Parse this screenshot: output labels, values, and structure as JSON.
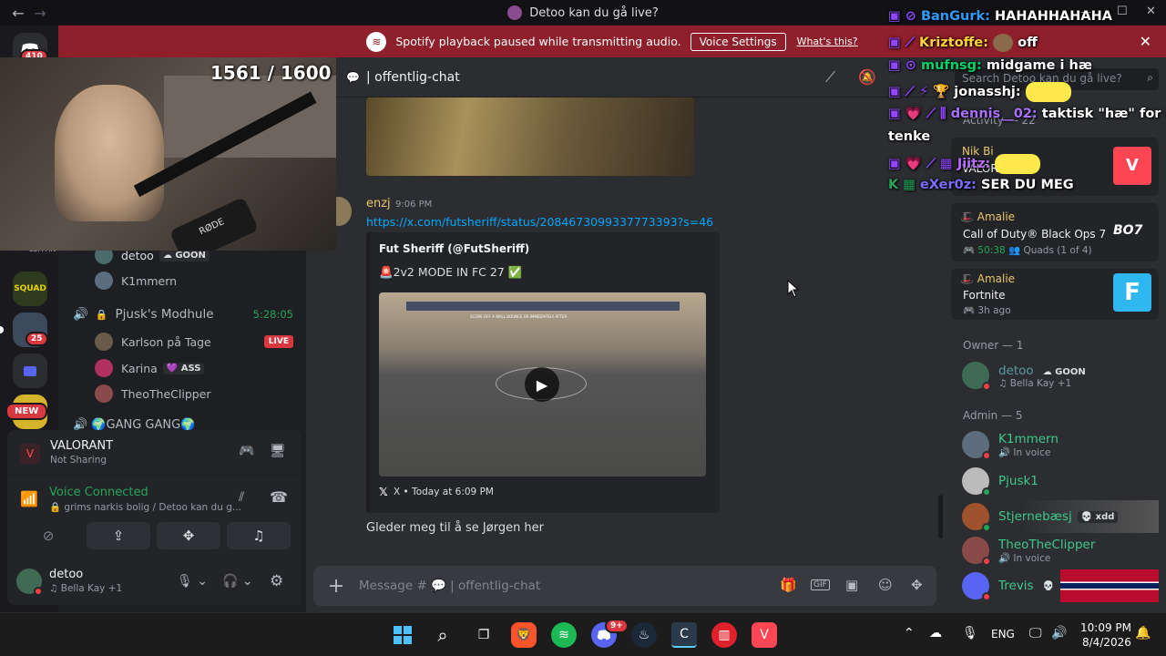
{
  "titlebar": {
    "title": "Detoo kan du gå live?",
    "back": "←",
    "forward": "→",
    "minimize": "—",
    "maximize": "☐",
    "close": "✕"
  },
  "notice": {
    "text": "Spotify playback paused while transmitting audio.",
    "button": "Voice Settings",
    "link": "What's this?",
    "close": "✕"
  },
  "rail": {
    "home_badge": "410",
    "server_badge": "25",
    "new_badge": "NEW",
    "squad_label": "SQUAD"
  },
  "stream": {
    "counter": "1561 / 1600",
    "mic_brand": "RØDE"
  },
  "channels": {
    "voice_members_a": [
      {
        "name": "detoo",
        "tag": "GOON"
      },
      {
        "name": "K1mmern"
      }
    ],
    "voice_channel": {
      "name": "Pjusk's Modhule",
      "time": "5:28:05"
    },
    "voice_members_b": [
      {
        "name": "Karlson på Tage",
        "live": "LIVE"
      },
      {
        "name": "Karina",
        "tag": "ASS"
      },
      {
        "name": "TheoTheClipper"
      }
    ],
    "partial_channel": "GANG GANG",
    "partial_label": "LUA-AN"
  },
  "panel": {
    "activity_name": "VALORANT",
    "activity_status": "Not Sharing",
    "voice_status": "Voice Connected",
    "voice_location": "grims narkis bolig / Detoo kan du g...",
    "user_name": "detoo",
    "user_status": "Bella Kay +1"
  },
  "chat": {
    "channel_name": "offentlig-chat",
    "messages": [
      {
        "author": "enzj",
        "time": "9:06 PM",
        "link": "https://x.com/futsheriff/status/2084673099337773393?s=46",
        "embed": {
          "author": "Fut Sheriff (@FutSheriff)",
          "text": "2v2 MODE IN FC 27 ✅",
          "footer": "X • Today at 6:09 PM",
          "video_caption": "SCORE OFF A WALL BOUNCE OR IMMEDIATELY AFTER"
        }
      },
      {
        "text": "Gleder meg til å se Jørgen her"
      }
    ],
    "input_placeholder": "Message # 💬 | offentlig-chat"
  },
  "right": {
    "search_placeholder": "Search Detoo kan du gå live?",
    "activity_header": "Activity — 22",
    "activities": [
      {
        "user": "Nik Bi",
        "game": "VALORANT"
      },
      {
        "user": "Amalie",
        "game": "Call of Duty® Black Ops 7",
        "elapsed": "50:38",
        "detail": "Quads (1 of 4)",
        "logo": "BO7"
      },
      {
        "user": "Amalie",
        "game": "Fortnite",
        "elapsed": "3h ago",
        "logo": "F"
      }
    ],
    "owner_header": "Owner — 1",
    "owner": {
      "name": "detoo",
      "tag": "GOON",
      "status": "Bella Kay +1"
    },
    "admin_header": "Admin — 5",
    "admins": [
      {
        "name": "K1mmern",
        "status": "In voice"
      },
      {
        "name": "Pjusk1"
      },
      {
        "name": "Stjernebæsj",
        "tag": "xdd"
      },
      {
        "name": "TheoTheClipper",
        "status": "In voice"
      },
      {
        "name": "Trevis"
      }
    ]
  },
  "twitch_chat": [
    {
      "user": "BanGurk:",
      "msg": "HAHAHHAHAHA",
      "color": "#2e9bff"
    },
    {
      "user": "Kriztoffe:",
      "msg": "off",
      "color": "#ffd23c"
    },
    {
      "user": "mufnsg:",
      "msg": "midgame i hæ",
      "color": "#00d26a"
    },
    {
      "user": "jonasshj:",
      "msg": "",
      "color": "#ffffff"
    },
    {
      "user": "dennis__02:",
      "msg": "taktisk \"hæ\" for å",
      "msg2": "tenke",
      "color": "#a970ff"
    },
    {
      "user": "Jiitz:",
      "msg": "",
      "color": "#b96bff"
    },
    {
      "user": "eXer0z:",
      "msg": "SER DU MEG",
      "color": "#7b6bff"
    }
  ],
  "taskbar": {
    "lang": "ENG",
    "time": "10:09 PM",
    "date": "8/4/2026",
    "discord_badge": "9+"
  },
  "colors": {
    "accent_green": "#23a55a",
    "live_red": "#d8383e",
    "notice_red": "#8f1f2a",
    "link_blue": "#00a8fc"
  }
}
